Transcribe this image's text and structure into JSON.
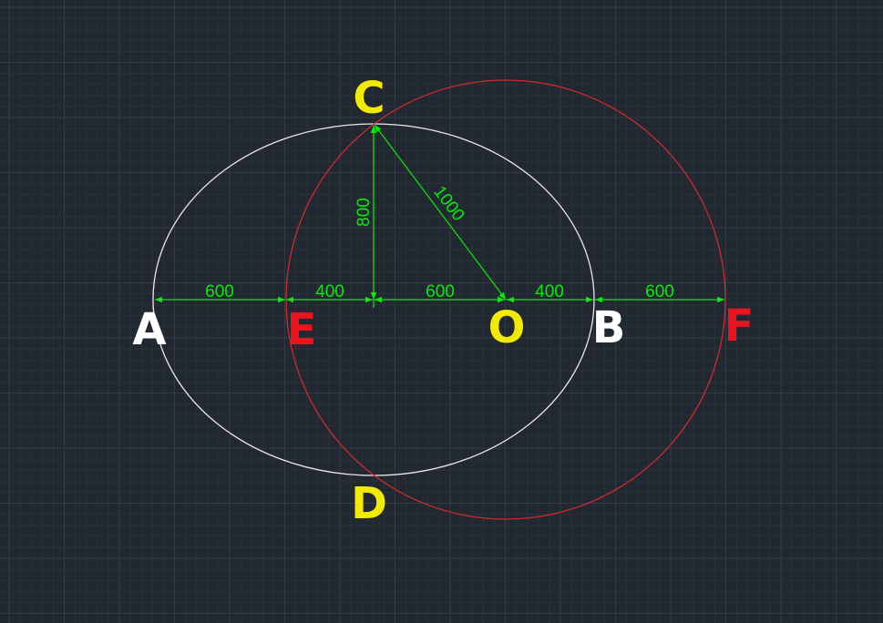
{
  "colors": {
    "background": "#222832",
    "grid_minor": "#2b313b",
    "grid_major": "#343b47",
    "ellipse": "#e8e8e8",
    "circle": "#cc2b2b",
    "dimension": "#00ee00",
    "label_yellow": "#f2ea00",
    "label_white": "#ffffff",
    "label_red": "#e8141e"
  },
  "points": {
    "A": "A",
    "B": "B",
    "C": "C",
    "D": "D",
    "E": "E",
    "F": "F",
    "O": "O"
  },
  "dimensions": {
    "ae": "600",
    "ec": "400",
    "co": "600",
    "ob": "400",
    "bf": "600",
    "vertical": "800",
    "diagonal": "1000"
  }
}
